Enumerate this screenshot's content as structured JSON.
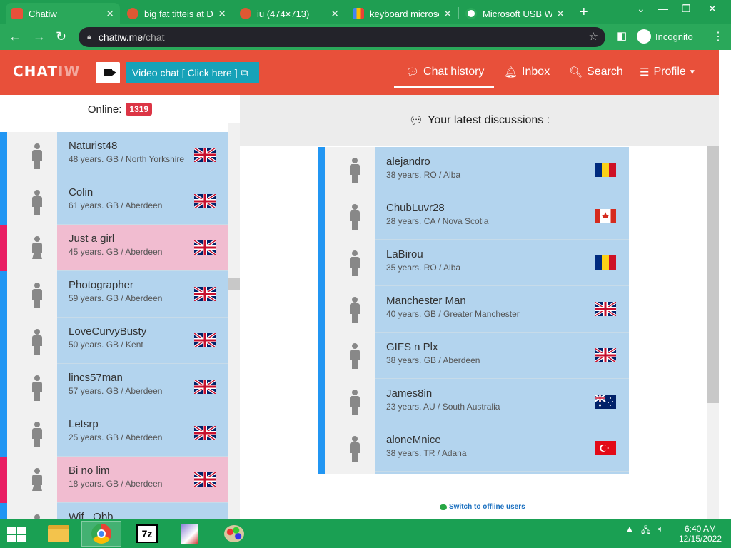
{
  "browser": {
    "tabs": [
      {
        "title": "Chatiw",
        "active": true,
        "favicon": "chatiw-icon",
        "color": "#e8503a"
      },
      {
        "title": "big fat titteis at D",
        "active": false,
        "favicon": "duckduckgo-icon",
        "color": "#de5833"
      },
      {
        "title": "iu (474×713)",
        "active": false,
        "favicon": "duckduckgo-icon",
        "color": "#de5833"
      },
      {
        "title": "keyboard microsc",
        "active": false,
        "favicon": "bing-icon",
        "color": "#4285f4"
      },
      {
        "title": "Microsoft USB W",
        "active": false,
        "favicon": "globe-icon",
        "color": "#2aa85a"
      }
    ],
    "url_host": "chatiw.me",
    "url_path": "/chat",
    "incognito_label": "Incognito"
  },
  "header": {
    "logo": "CHAT",
    "logo_suffix": "IW",
    "video_chat_label": "Video chat  [ Click here ]",
    "nav": {
      "chat_history": "Chat history",
      "inbox": "Inbox",
      "search": "Search",
      "profile": "Profile"
    }
  },
  "sidebar": {
    "online_label": "Online:",
    "online_count": "1319",
    "users": [
      {
        "name": "Naturist48",
        "info": "48 years. GB / North Yorkshire",
        "gender": "male",
        "country": "GB"
      },
      {
        "name": "Colin",
        "info": "61 years. GB / Aberdeen",
        "gender": "male",
        "country": "GB"
      },
      {
        "name": "Just a girl",
        "info": "45 years. GB / Aberdeen",
        "gender": "female",
        "country": "GB"
      },
      {
        "name": "Photographer",
        "info": "59 years. GB / Aberdeen",
        "gender": "male",
        "country": "GB"
      },
      {
        "name": "LoveCurvyBusty",
        "info": "50 years. GB / Kent",
        "gender": "male",
        "country": "GB"
      },
      {
        "name": "lincs57man",
        "info": "57 years. GB / Aberdeen",
        "gender": "male",
        "country": "GB"
      },
      {
        "name": "Letsrp",
        "info": "25 years. GB / Aberdeen",
        "gender": "male",
        "country": "GB"
      },
      {
        "name": "Bi no lim",
        "info": "18 years. GB / Aberdeen",
        "gender": "female",
        "country": "GB"
      },
      {
        "name": "Wif...Obb",
        "info": "",
        "gender": "male",
        "country": "GB"
      }
    ]
  },
  "main": {
    "heading": "Your latest discussions :",
    "discussions": [
      {
        "name": "alejandro",
        "info": "38 years. RO / Alba",
        "country": "RO"
      },
      {
        "name": "ChubLuvr28",
        "info": "28 years. CA / Nova Scotia",
        "country": "CA"
      },
      {
        "name": "LaBirou",
        "info": "35 years. RO / Alba",
        "country": "RO"
      },
      {
        "name": "Manchester Man",
        "info": "40 years. GB / Greater Manchester",
        "country": "GB"
      },
      {
        "name": "GIFS n Plx",
        "info": "38 years. GB / Aberdeen",
        "country": "GB"
      },
      {
        "name": "James8in",
        "info": "23 years. AU / South Australia",
        "country": "AU"
      },
      {
        "name": "aloneMnice",
        "info": "38 years. TR / Adana",
        "country": "TR"
      }
    ],
    "switch_label": "Switch to offline users"
  },
  "colors": {
    "male_side": "#2196f3",
    "female_side": "#e91e63",
    "male_card": "#b3d4ee",
    "female_card": "#f1bcd0",
    "header_red": "#e8503a"
  },
  "taskbar": {
    "time": "6:40 AM",
    "date": "12/15/2022",
    "items": [
      "windows-start",
      "file-explorer",
      "chrome",
      "7zip",
      "paint-app",
      "paint-palette"
    ]
  }
}
